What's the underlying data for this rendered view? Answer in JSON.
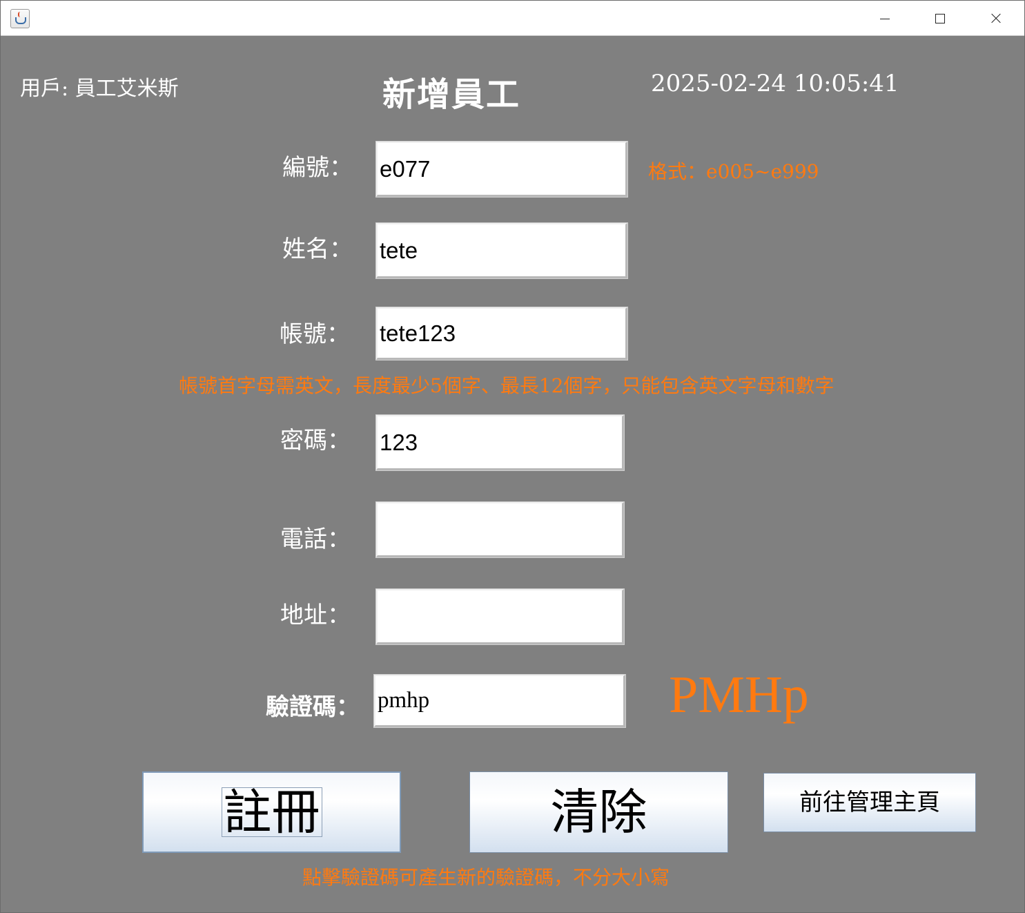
{
  "window": {
    "app_icon": "java-cup-icon",
    "controls": [
      "minimize-icon",
      "maximize-icon",
      "close-icon"
    ]
  },
  "header": {
    "user": "用戶: 員工艾米斯",
    "title": "新增員工",
    "datetime": "2025-02-24 10:05:41"
  },
  "form": {
    "id_label": "編號：",
    "id_value": "e077",
    "id_format_hint": "格式：e005~e999",
    "name_label": "姓名：",
    "name_value": "tete",
    "account_label": "帳號：",
    "account_value": "tete123",
    "account_rule_hint": "帳號首字母需英文，長度最少5個字、最長12個字，只能包含英文字母和數字",
    "password_label": "密碼：",
    "password_value": "123",
    "phone_label": "電話：",
    "phone_value": "",
    "address_label": "地址：",
    "address_value": "",
    "captcha_label": "驗證碼：",
    "captcha_value": "pmhp",
    "captcha_image_text": "PMHp"
  },
  "buttons": {
    "register": "註冊",
    "clear": "清除",
    "goto_admin": "前往管理主頁"
  },
  "footer_hint": "點擊驗證碼可產生新的驗證碼，不分大小寫",
  "colors": {
    "background": "#808080",
    "hint": "#ff7a10",
    "text": "#ffffff"
  }
}
